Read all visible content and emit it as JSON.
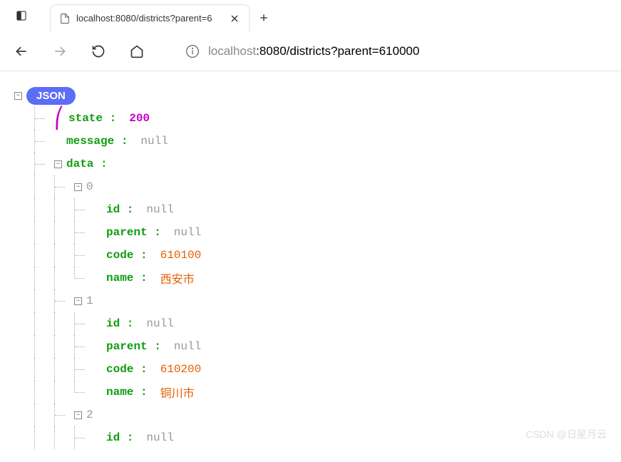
{
  "browser": {
    "tab_title": "localhost:8080/districts?parent=6",
    "new_tab_tooltip": "+",
    "url_display": "localhost:8080/districts?parent=610000",
    "url_host": "localhost",
    "url_port": ":8080",
    "url_path": "/districts?parent=610000"
  },
  "json_badge": "JSON",
  "response": {
    "state_key": "state",
    "state_value": "200",
    "message_key": "message",
    "message_value": "null",
    "data_key": "data",
    "items": [
      {
        "index": "0",
        "id_key": "id",
        "id_value": "null",
        "parent_key": "parent",
        "parent_value": "null",
        "code_key": "code",
        "code_value": "610100",
        "name_key": "name",
        "name_value": "西安市"
      },
      {
        "index": "1",
        "id_key": "id",
        "id_value": "null",
        "parent_key": "parent",
        "parent_value": "null",
        "code_key": "code",
        "code_value": "610200",
        "name_key": "name",
        "name_value": "铜川市"
      },
      {
        "index": "2",
        "id_key": "id",
        "id_value": "null"
      }
    ]
  },
  "watermark": "CSDN @日星月云"
}
